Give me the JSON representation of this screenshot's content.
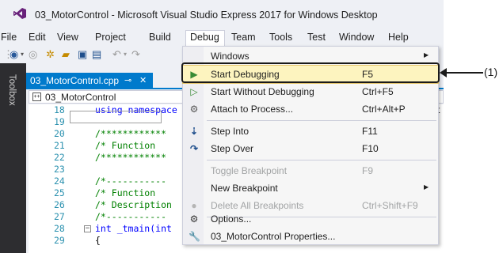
{
  "window": {
    "title": "03_MotorControl - Microsoft Visual Studio Express 2017 for Windows Desktop"
  },
  "menubar": {
    "items": [
      "File",
      "Edit",
      "View",
      "Project",
      "Build",
      "Debug",
      "Team",
      "Tools",
      "Test",
      "Window",
      "Help"
    ]
  },
  "sidebar": {
    "toolbox_label": "Toolbox"
  },
  "editor": {
    "tab_title": "03_MotorControl.cpp",
    "tab_pin": "⊸",
    "tab_close": "✕",
    "nav_project": "03_MotorControl",
    "right_edge_text": "t",
    "lines": [
      {
        "num": "18",
        "text": "using namespace"
      },
      {
        "num": "19",
        "text": ""
      },
      {
        "num": "20",
        "text": "/************"
      },
      {
        "num": "21",
        "text": "/* Function"
      },
      {
        "num": "22",
        "text": "/************"
      },
      {
        "num": "23",
        "text": ""
      },
      {
        "num": "24",
        "text": "/*-----------"
      },
      {
        "num": "25",
        "text": "/* Function"
      },
      {
        "num": "26",
        "text": "/* Description"
      },
      {
        "num": "27",
        "text": "/*-----------"
      },
      {
        "num": "28",
        "text": "int _tmain(int"
      },
      {
        "num": "29",
        "text": "{"
      }
    ]
  },
  "debug_menu": {
    "items": [
      {
        "label": "Windows",
        "shortcut": "",
        "submenu": true,
        "disabled": false,
        "icon": ""
      },
      {
        "label": "Start Debugging",
        "shortcut": "F5",
        "submenu": false,
        "disabled": false,
        "icon": "play-icon"
      },
      {
        "label": "Start Without Debugging",
        "shortcut": "Ctrl+F5",
        "submenu": false,
        "disabled": false,
        "icon": "play-outline-icon"
      },
      {
        "label": "Attach to Process...",
        "shortcut": "Ctrl+Alt+P",
        "submenu": false,
        "disabled": false,
        "icon": "attach-icon"
      },
      {
        "label": "Step Into",
        "shortcut": "F11",
        "submenu": false,
        "disabled": false,
        "icon": "step-into-icon"
      },
      {
        "label": "Step Over",
        "shortcut": "F10",
        "submenu": false,
        "disabled": false,
        "icon": "step-over-icon"
      },
      {
        "label": "Toggle Breakpoint",
        "shortcut": "F9",
        "submenu": false,
        "disabled": true,
        "icon": ""
      },
      {
        "label": "New Breakpoint",
        "shortcut": "",
        "submenu": true,
        "disabled": false,
        "icon": ""
      },
      {
        "label": "Delete All Breakpoints",
        "shortcut": "Ctrl+Shift+F9",
        "submenu": false,
        "disabled": true,
        "icon": "delete-breakpoints-icon"
      },
      {
        "label": "Options...",
        "shortcut": "",
        "submenu": false,
        "disabled": false,
        "icon": "gear-icon"
      },
      {
        "label": "03_MotorControl Properties...",
        "shortcut": "",
        "submenu": false,
        "disabled": false,
        "icon": "wrench-icon"
      }
    ]
  },
  "annotation": {
    "label": "(1)"
  },
  "colors": {
    "accent": "#007acc",
    "highlight_fill": "#fdf4bf",
    "highlight_border": "#e5c365",
    "play_green": "#388a34",
    "comment_green": "#008000",
    "keyword_blue": "#0000ff",
    "line_number": "#2b91af"
  }
}
